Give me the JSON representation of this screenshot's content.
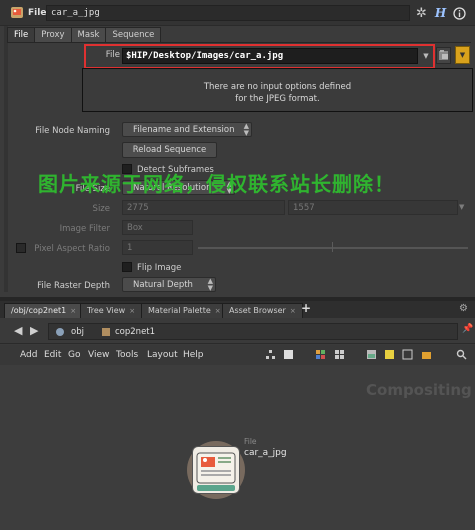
{
  "title_bar": {
    "node_type": "File",
    "node_name": "car_a_jpg",
    "icons": [
      "gear-icon",
      "help-icon",
      "info-icon"
    ]
  },
  "tabs": [
    "File",
    "Proxy",
    "Mask",
    "Sequence"
  ],
  "file_param": {
    "label": "File",
    "value": "$HIP/Desktop/Images/car_a.jpg",
    "dropdown": "▼"
  },
  "info_message": {
    "line1": "There are no input options defined",
    "line2": "for the JPEG format."
  },
  "params": {
    "naming_label": "File Node Naming",
    "naming_value": "Filename and Extension",
    "reload_button": "Reload Sequence",
    "detect_subframes": "Detect Subframes",
    "file_size_label": "File Size",
    "file_size_value": "Natural Resolution",
    "size_label": "Size",
    "size_w": "2775",
    "size_h": "1557",
    "image_filter_label": "Image Filter",
    "image_filter_value": "Box",
    "pixel_aspect_label": "Pixel Aspect Ratio",
    "pixel_aspect_value": "1",
    "flip_image": "Flip Image",
    "raster_depth_label": "File Raster Depth",
    "raster_depth_value": "Natural Depth"
  },
  "watermark": "图片来源于网络，侵权联系站长删除！",
  "pane_tabs": [
    {
      "label": "/obj/cop2net1",
      "active": true
    },
    {
      "label": "Tree View",
      "active": false
    },
    {
      "label": "Material Palette",
      "active": false
    },
    {
      "label": "Asset Browser",
      "active": false
    }
  ],
  "pane_tab_close": "×",
  "path": {
    "level1": "obj",
    "level2": "cop2net1"
  },
  "menu": [
    "Add",
    "Edit",
    "Go",
    "View",
    "Tools",
    "Layout",
    "Help"
  ],
  "network": {
    "context_label": "Compositing",
    "node_type": "File",
    "node_name": "car_a_jpg"
  },
  "colors": {
    "highlight_box": "#e03131",
    "watermark": "#2fbf2f",
    "accent_button": "#d9a21c"
  }
}
